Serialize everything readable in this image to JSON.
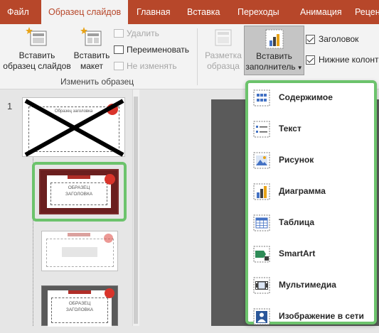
{
  "tabs": [
    {
      "label": "Файл",
      "active": false
    },
    {
      "label": "Образец слайдов",
      "active": true
    },
    {
      "label": "Главная",
      "active": false
    },
    {
      "label": "Вставка",
      "active": false
    },
    {
      "label": "Переходы",
      "active": false
    },
    {
      "label": "Анимация",
      "active": false
    },
    {
      "label": "Реценз",
      "active": false
    }
  ],
  "ribbon": {
    "insert_master": {
      "line1": "Вставить",
      "line2": "образец слайдов"
    },
    "insert_layout": {
      "line1": "Вставить",
      "line2": "макет"
    },
    "delete": "Удалить",
    "rename": "Переименовать",
    "preserve": "Не изменять",
    "group_edit_master": "Изменить образец",
    "master_layout": {
      "line1": "Разметка",
      "line2": "образца"
    },
    "insert_placeholder": {
      "line1": "Вставить",
      "line2": "заполнитель"
    },
    "title_checkbox": "Заголовок",
    "footers_checkbox": "Нижние колонт"
  },
  "slides": {
    "number": "1",
    "layout_title_line1": "ОБРАЗЕЦ",
    "layout_title_line2": "ЗАГОЛОВКА",
    "master_title": "Образец заголовка"
  },
  "placeholder_menu": [
    {
      "label": "Содержимое",
      "icon": "content-icon"
    },
    {
      "label": "Текст",
      "icon": "text-icon"
    },
    {
      "label": "Рисунок",
      "icon": "picture-icon"
    },
    {
      "label": "Диаграмма",
      "icon": "chart-icon"
    },
    {
      "label": "Таблица",
      "icon": "table-icon"
    },
    {
      "label": "SmartArt",
      "icon": "smartart-icon"
    },
    {
      "label": "Мультимедиа",
      "icon": "media-icon"
    },
    {
      "label": "Изображение в сети",
      "icon": "online-picture-icon"
    }
  ],
  "colors": {
    "accent": "#b7472a",
    "highlight": "#6cc36c"
  }
}
